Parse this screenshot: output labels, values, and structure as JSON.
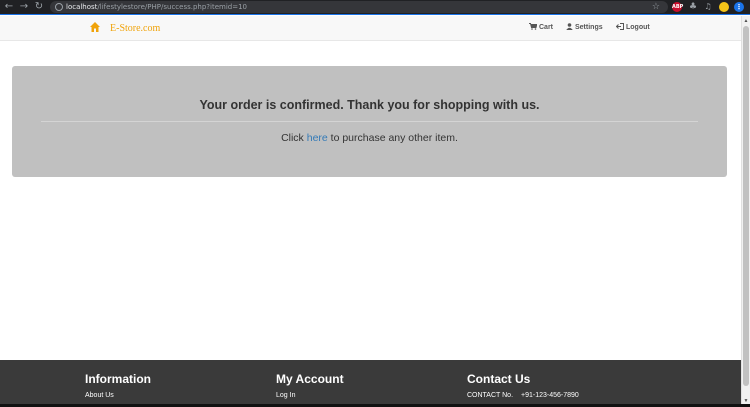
{
  "browser": {
    "url_host": "localhost",
    "url_path": "/lifestylestore/PHP/success.php?itemid=10",
    "extensions": [
      {
        "name": "adblock-icon",
        "label": "ABP",
        "color": "#c70d2c"
      },
      {
        "name": "puzzle-icon",
        "label": "",
        "color": "#5f6368"
      },
      {
        "name": "media-icon",
        "label": "",
        "color": "#5f6368"
      },
      {
        "name": "profile-avatar",
        "label": "",
        "color": "#f5c518"
      },
      {
        "name": "menu-icon",
        "label": "",
        "color": "#1a73e8"
      }
    ]
  },
  "navbar": {
    "brand": "E-Store.com",
    "cart": "Cart",
    "settings": "Settings",
    "logout": "Logout"
  },
  "jumbotron": {
    "title": "Your order is confirmed. Thank you for shopping with us.",
    "click_prefix": "Click",
    "link_text": "here",
    "click_suffix": "to purchase any other item."
  },
  "footer": {
    "information": {
      "heading": "Information",
      "link": "About Us"
    },
    "account": {
      "heading": "My Account",
      "link": "Log In"
    },
    "contact": {
      "heading": "Contact Us",
      "label": "CONTACT No.",
      "number": "+91-123-456-7890"
    }
  },
  "colors": {
    "brand": "#f0a30a",
    "jumbotron_bg": "#c0c0c0",
    "link": "#337ab7",
    "footer_bg": "#3a3a3a"
  }
}
